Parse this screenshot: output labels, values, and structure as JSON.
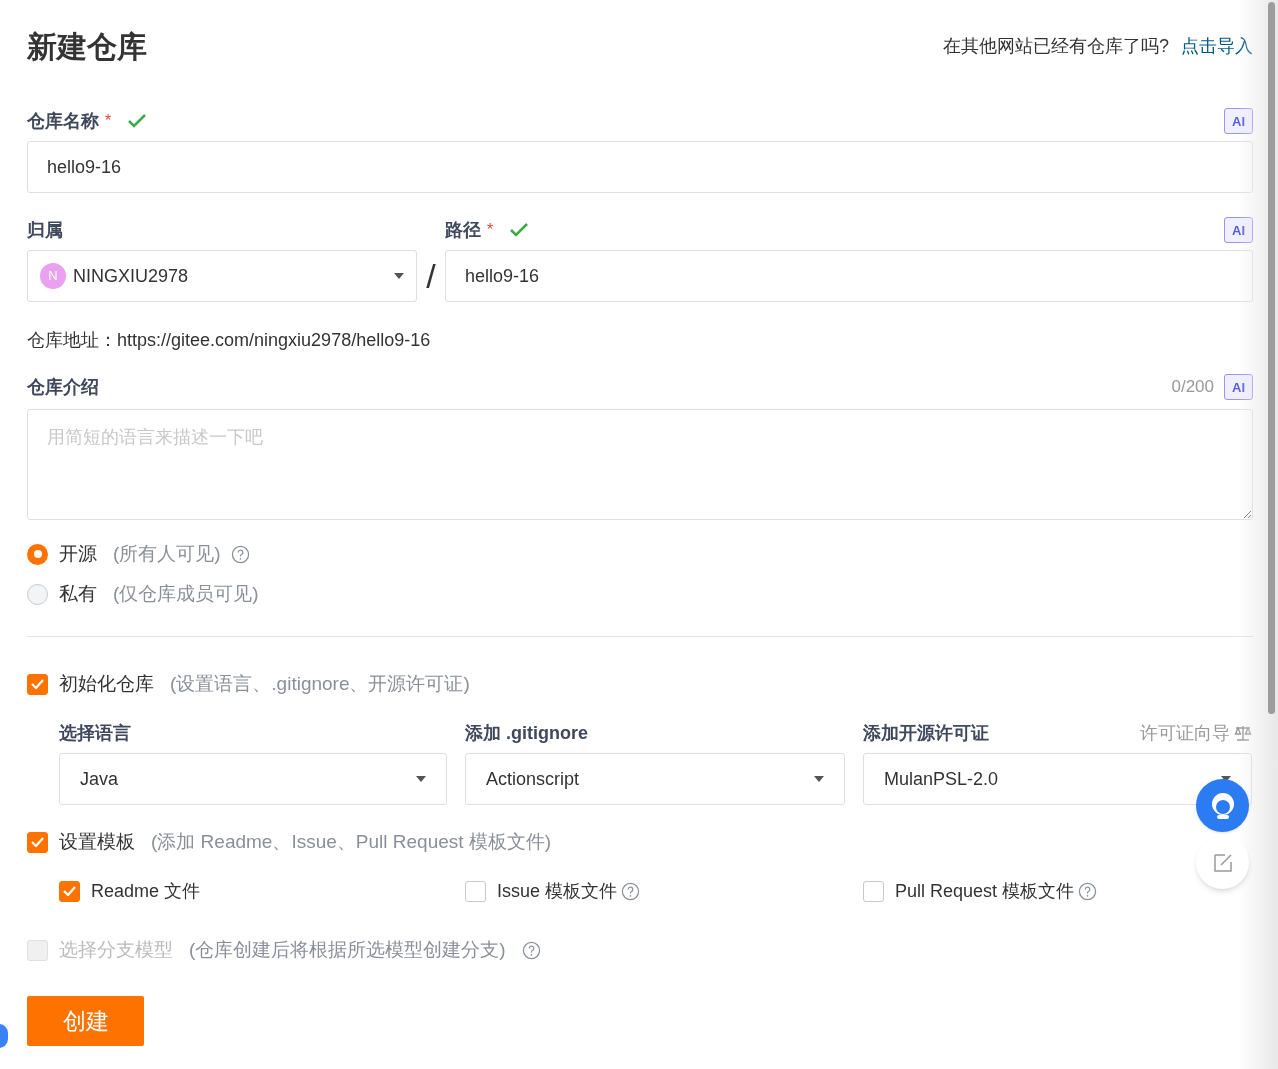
{
  "title": "新建仓库",
  "import_prompt": {
    "text": "在其他网站已经有仓库了吗?",
    "link": "点击导入"
  },
  "name_field": {
    "label": "仓库名称",
    "required": "*",
    "valid": true,
    "ai": "AI",
    "value": "hello9-16"
  },
  "owner": {
    "label": "归属",
    "avatar": "N",
    "value": "NINGXIU2978"
  },
  "separator": "/",
  "path_field": {
    "label": "路径",
    "required": "*",
    "valid": true,
    "ai": "AI",
    "value": "hello9-16"
  },
  "address": {
    "label": "仓库地址：",
    "url": "https://gitee.com/ningxiu2978/hello9-16"
  },
  "description": {
    "label": "仓库介绍",
    "counter": "0/200",
    "ai": "AI",
    "placeholder": "用简短的语言来描述一下吧"
  },
  "visibility": [
    {
      "label": "开源",
      "hint": "(所有人可见)",
      "selected": true,
      "help": true
    },
    {
      "label": "私有",
      "hint": "(仅仓库成员可见)",
      "selected": false,
      "help": false
    }
  ],
  "init": {
    "checked": true,
    "label": "初始化仓库",
    "hint": "(设置语言、.gitignore、开源许可证)"
  },
  "selects": [
    {
      "label": "选择语言",
      "value": "Java"
    },
    {
      "label": "添加 .gitignore",
      "value": "Actionscript"
    },
    {
      "label": "添加开源许可证",
      "value": "MulanPSL-2.0",
      "guide": "许可证向导"
    }
  ],
  "template": {
    "checked": true,
    "label": "设置模板",
    "hint": "(添加 Readme、Issue、Pull Request 模板文件)",
    "options": [
      {
        "label": "Readme 文件",
        "checked": true,
        "help": false
      },
      {
        "label": "Issue 模板文件",
        "checked": false,
        "help": true
      },
      {
        "label": "Pull Request 模板文件",
        "checked": false,
        "help": true
      }
    ]
  },
  "branch": {
    "checked": false,
    "disabled": true,
    "label": "选择分支模型",
    "hint": "(仓库创建后将根据所选模型创建分支)",
    "help": true
  },
  "submit": "创建"
}
